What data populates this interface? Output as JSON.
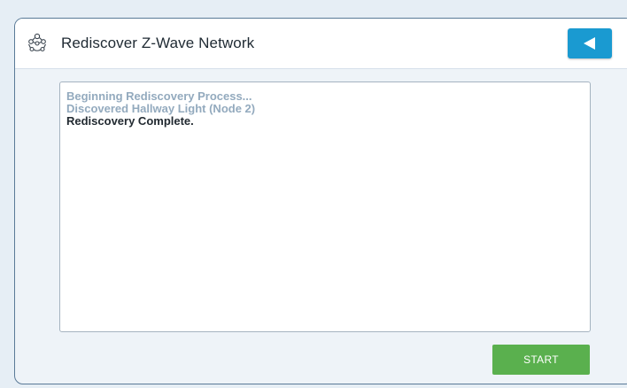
{
  "header": {
    "icon": "network-nodes-icon",
    "title": "Rediscover Z-Wave Network",
    "back_icon": "back-arrow-icon"
  },
  "log": {
    "lines": [
      "Beginning Rediscovery Process...",
      "Discovered Hallway Light (Node 2)",
      "Rediscovery Complete."
    ]
  },
  "actions": {
    "start_label": "START"
  },
  "colors": {
    "accent": "#1a9ad1",
    "start_button": "#5ab04e",
    "faded_text": "#93aabe",
    "panel_border": "#5a7a97"
  }
}
